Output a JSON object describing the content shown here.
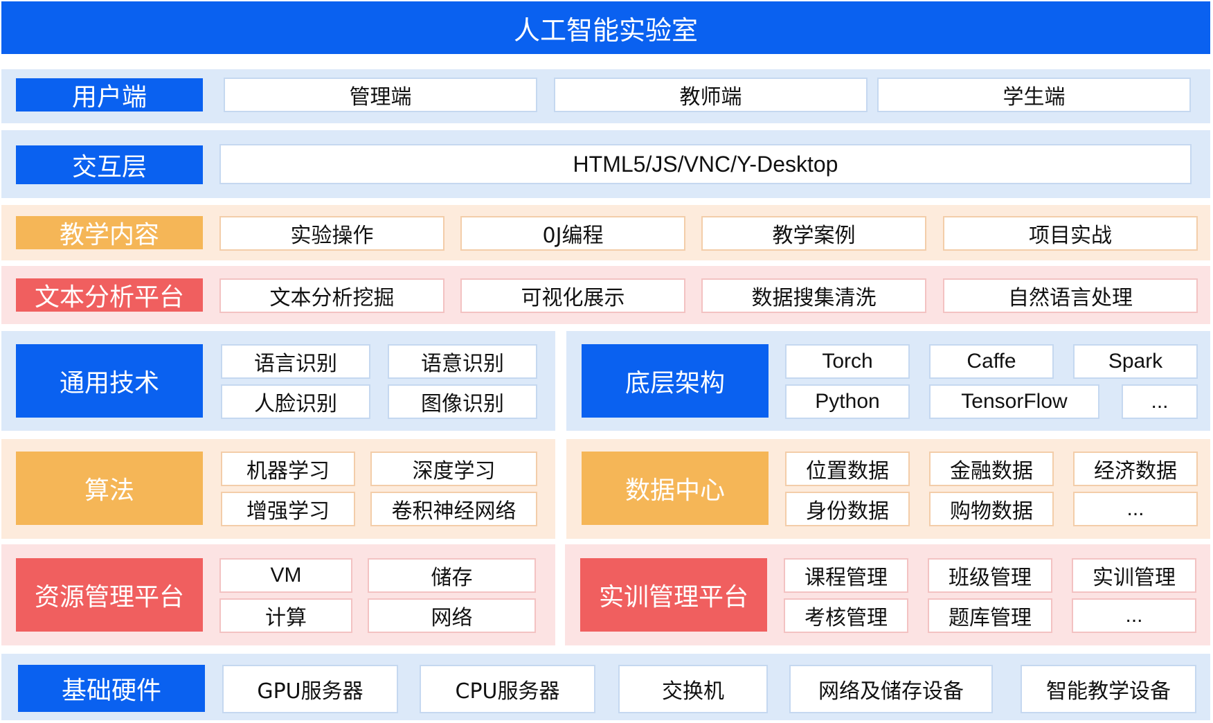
{
  "title": "人工智能实验室",
  "user_end": {
    "label": "用户端",
    "items": [
      "管理端",
      "教师端",
      "学生端"
    ]
  },
  "interaction": {
    "label": "交互层",
    "items": [
      "HTML5/JS/VNC/Y-Desktop"
    ]
  },
  "teaching": {
    "label": "教学内容",
    "items": [
      "实验操作",
      "0J编程",
      "教学案例",
      "项目实战"
    ]
  },
  "text_analysis": {
    "label": "文本分析平台",
    "items": [
      "文本分析挖掘",
      "可视化展示",
      "数据搜集清洗",
      "自然语言处理"
    ]
  },
  "general_tech": {
    "label": "通用技术",
    "items": [
      "语言识别",
      "语意识别",
      "人脸识别",
      "图像识别"
    ]
  },
  "architecture": {
    "label": "底层架构",
    "items": [
      "Torch",
      "Caffe",
      "Spark",
      "Python",
      "TensorFlow",
      "..."
    ]
  },
  "algorithm": {
    "label": "算法",
    "items": [
      "机器学习",
      "深度学习",
      "增强学习",
      "卷积神经网络"
    ]
  },
  "data_center": {
    "label": "数据中心",
    "items": [
      "位置数据",
      "金融数据",
      "经济数据",
      "身份数据",
      "购物数据",
      "..."
    ]
  },
  "resource_mgmt": {
    "label": "资源管理平台",
    "items": [
      "VM",
      "储存",
      "计算",
      "网络"
    ]
  },
  "training_mgmt": {
    "label": "实训管理平台",
    "items": [
      "课程管理",
      "班级管理",
      "实训管理",
      "考核管理",
      "题库管理",
      "..."
    ]
  },
  "hardware": {
    "label": "基础硬件",
    "items": [
      "GPU服务器",
      "CPU服务器",
      "交换机",
      "网络及储存设备",
      "智能教学设备"
    ]
  },
  "colors": {
    "blue": "#0a61f0",
    "orange": "#f5b657",
    "red": "#f05f5f",
    "band_blue": "#dce9f9",
    "band_orange": "#fdebdc",
    "band_pink": "#fce3e3"
  }
}
